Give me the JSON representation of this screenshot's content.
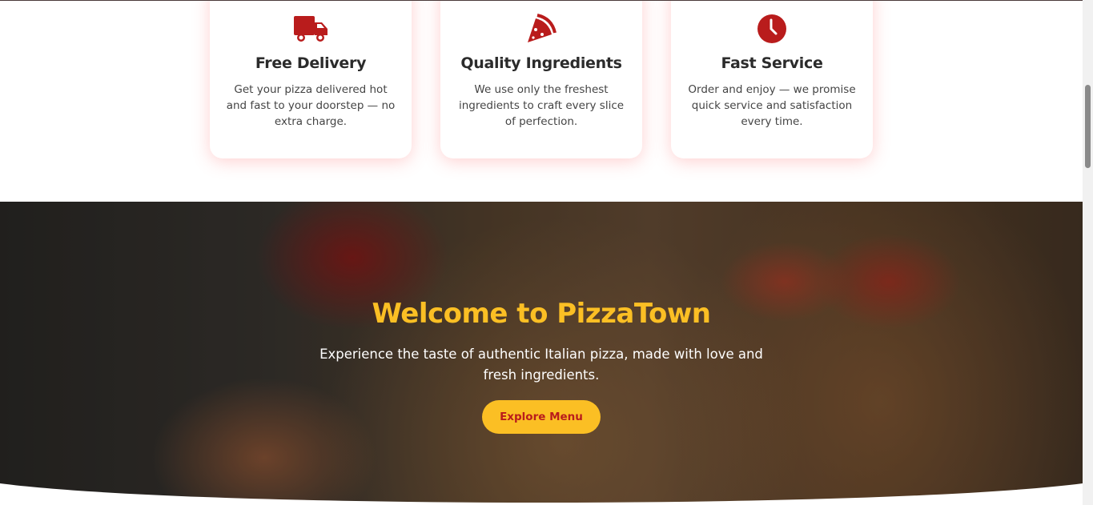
{
  "features": [
    {
      "icon": "truck-icon",
      "title": "Free Delivery",
      "text": "Get your pizza delivered hot and fast to your doorstep — no extra charge."
    },
    {
      "icon": "pizza-slice-icon",
      "title": "Quality Ingredients",
      "text": "We use only the freshest ingredients to craft every slice of perfection."
    },
    {
      "icon": "clock-icon",
      "title": "Fast Service",
      "text": "Order and enjoy — we promise quick service and satisfaction every time."
    }
  ],
  "hero": {
    "title": "Welcome to PizzaTown",
    "subtitle": "Experience the taste of authentic Italian pizza, made with love and fresh ingredients.",
    "button": "Explore Menu"
  },
  "colors": {
    "accent": "#b91c1c",
    "yellow": "#fbbf24"
  }
}
